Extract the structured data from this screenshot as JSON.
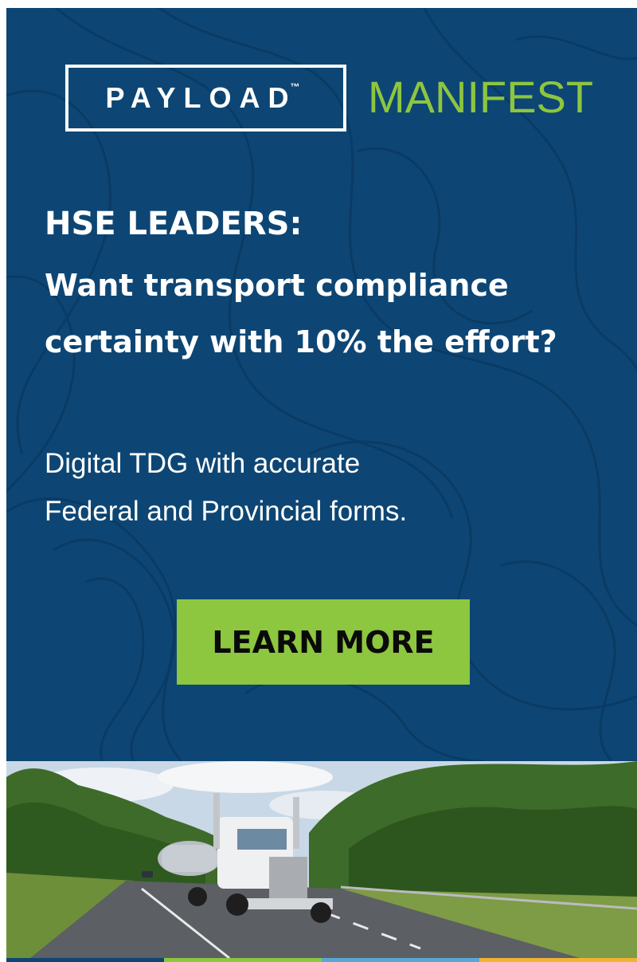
{
  "logo": {
    "brand": "PAYLOAD",
    "trademark": "™",
    "product": "MANIFEST"
  },
  "headline": {
    "line1": "HSE LEADERS:",
    "line2": "Want transport compliance",
    "line3": "certainty with 10% the effort?"
  },
  "body": {
    "line1": "Digital TDG with accurate",
    "line2": "Federal and Provincial forms."
  },
  "cta": {
    "label": "LEARN MORE"
  },
  "colors": {
    "background": "#0d4674",
    "accent_green": "#8dc63f",
    "text": "#ffffff",
    "stripe": [
      "#0d4674",
      "#8dc63f",
      "#5aa7d6",
      "#f2b233"
    ]
  },
  "image": {
    "subject": "tanker-truck-on-highway"
  }
}
